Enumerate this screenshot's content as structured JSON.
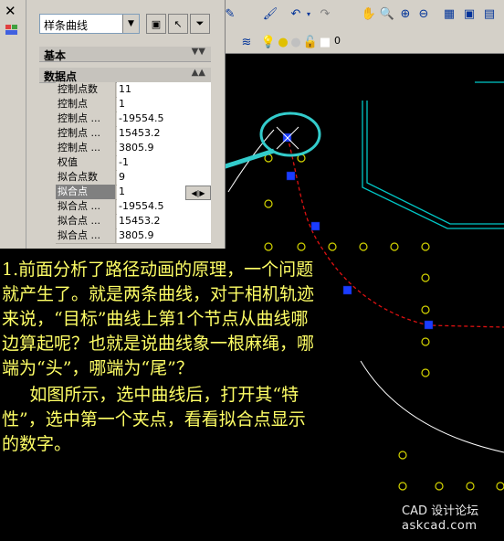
{
  "toolbar": {
    "buttons": [
      "layer-states-icon",
      "match-properties-icon",
      "undo-icon",
      "undo-dropdown-icon",
      "redo-icon",
      "pan-icon",
      "zoom-realtime-icon",
      "zoom-window-icon",
      "zoom-previous-icon",
      "properties-icon",
      "design-center-icon",
      "tool-palettes-icon"
    ]
  },
  "layer_bar": {
    "current_layer": "0"
  },
  "properties_palette": {
    "object_type": "样条曲线",
    "sections": [
      {
        "label": "基本",
        "collapsed": true
      },
      {
        "label": "数据点",
        "collapsed": false
      }
    ],
    "rows": [
      {
        "name": "控制点数",
        "value": "11"
      },
      {
        "name": "控制点",
        "value": "1"
      },
      {
        "name": "控制点 ...",
        "value": "-19554.5"
      },
      {
        "name": "控制点 ...",
        "value": "15453.2"
      },
      {
        "name": "控制点 ...",
        "value": "3805.9"
      },
      {
        "name": "权值",
        "value": "-1"
      },
      {
        "name": "拟合点数",
        "value": "9"
      },
      {
        "name": "拟合点",
        "value": "1"
      },
      {
        "name": "拟合点 ...",
        "value": "-19554.5"
      },
      {
        "name": "拟合点 ...",
        "value": "15453.2"
      },
      {
        "name": "拟合点 ...",
        "value": "3805.9"
      }
    ],
    "selected_row": 7
  },
  "explanation": {
    "paragraph1": "1.前面分析了路径动画的原理，一个问题就产生了。就是两条曲线，对于相机轨迹来说，“目标”曲线上第1个节点从曲线哪边算起呢？也就是说曲线象一根麻绳，哪端为“头”，哪端为“尾”？",
    "paragraph2": "如图所示，选中曲线后，打开其“特性”，选中第一个夹点，看看拟合点显示的数字。"
  },
  "watermark": {
    "line1": "CAD 设计论坛",
    "line2": "askcad.com"
  },
  "colors": {
    "canvas_bg": "#000000",
    "annotation_cyan": "#33cccc",
    "grip_blue": "#1a3cff",
    "curve_red": "#cc0000",
    "points_yellow": "#cccc00",
    "text_yellow": "#ffff66",
    "wall_cyan": "#00cccc"
  }
}
